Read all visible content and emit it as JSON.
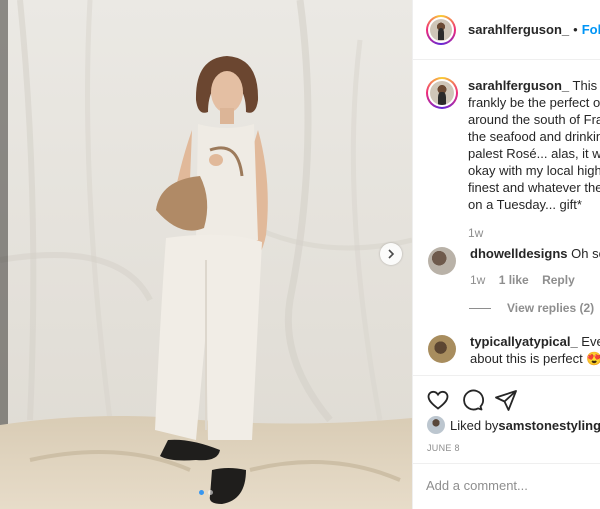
{
  "post": {
    "username": "sarahlferguson_",
    "separator": "•",
    "follow_label": "Follow"
  },
  "caption": {
    "username": "sarahlferguson_",
    "lines": [
      " This wo",
      "frankly be the perfect ou",
      "around the south of Fran",
      "the seafood and drinking",
      "palest Rosé... alas, it will",
      "okay with my local high s",
      "finest and whatever the",
      "on a Tuesday... gift*"
    ],
    "time": "1w"
  },
  "comments": [
    {
      "username": "dhowelldesigns",
      "text": " Oh so g",
      "time": "1w",
      "likes": "1 like",
      "reply_label": "Reply"
    },
    {
      "username": "typicallyatypical_",
      "line1": " Every",
      "line2": "about this is perfect 😍"
    }
  ],
  "view_replies": "View replies (2)",
  "liked_by": {
    "prefix": "Liked by ",
    "username": "samstonestyling",
    "suffix": " a"
  },
  "date": "JUNE 8",
  "add_comment": {
    "placeholder": "Add a comment..."
  },
  "carousel": {
    "total_slides": 2,
    "active_slide": 1
  },
  "colors": {
    "accent": "#0095f6",
    "active_dot": "#3897f0",
    "muted": "#8e8e8e"
  },
  "icons": [
    "heart-icon",
    "comment-icon",
    "share-icon",
    "chevron-right-icon"
  ]
}
